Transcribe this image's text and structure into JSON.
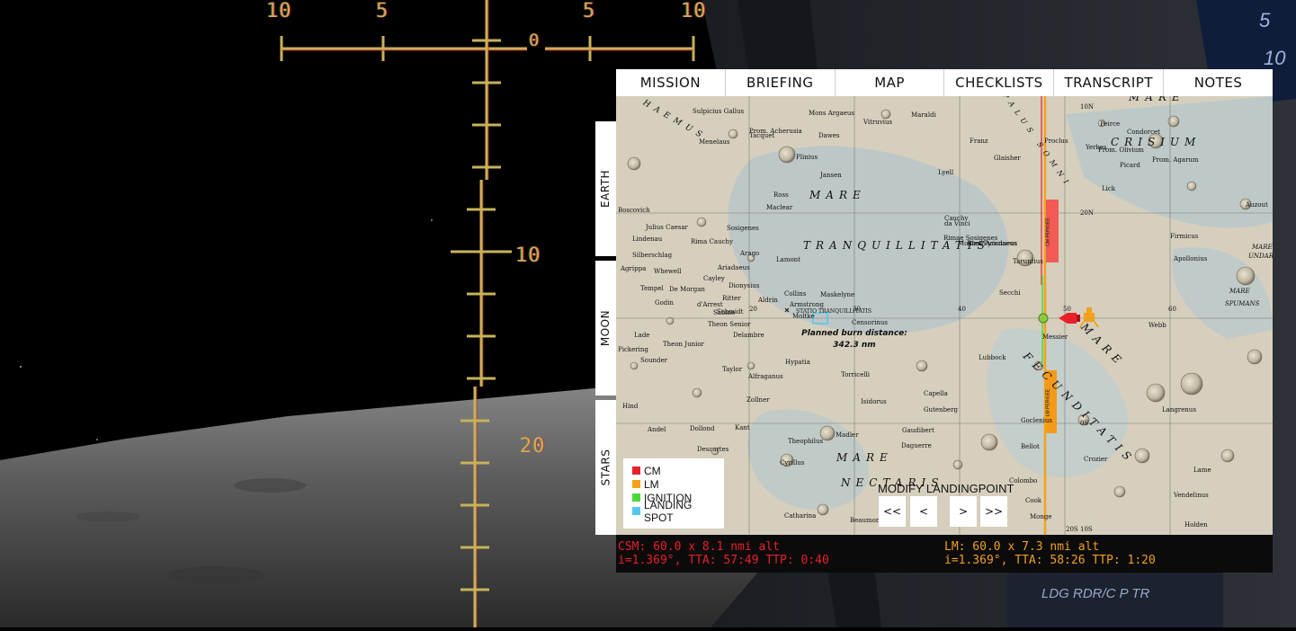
{
  "hud": {
    "scale_labels": [
      "10",
      "5",
      "0",
      "5",
      "10"
    ],
    "pitch_labels": [
      "10",
      "20"
    ]
  },
  "cockpit": {
    "label": "LDG RDR/C P TR",
    "gauge_digits": [
      "5",
      "10"
    ]
  },
  "tabs": [
    "MISSION",
    "BRIEFING",
    "MAP",
    "CHECKLISTS",
    "TRANSCRIPT",
    "NOTES"
  ],
  "side_tabs": [
    "EARTH",
    "MOON",
    "STARS"
  ],
  "map": {
    "mare_labels": [
      "MARE",
      "TRANQUILLITATIS",
      "MARE",
      "CRISIUM",
      "MARE",
      "FECUNDITATIS",
      "MARE",
      "NECTARIS",
      "HAEMUS",
      "PALUS SOMNI",
      "MARE",
      "SPUMANS",
      "MARE",
      "UNDARUM"
    ],
    "crater_labels": [
      "Sulpicius Gallus",
      "Menelaus",
      "Plinius",
      "Dawes",
      "Vitruvius",
      "Maraldi",
      "Jansen",
      "Ross",
      "Maclear",
      "Boscovich",
      "Julius Caesar",
      "Sosigenes",
      "Arago",
      "Lamont",
      "Silberschlag",
      "Agrippa",
      "Whewell",
      "Ariadaeus",
      "Cayley",
      "Dionysius",
      "Tempel",
      "De Morgan",
      "Ritter",
      "Godin",
      "d'Arrest",
      "Schmidt",
      "Sabine",
      "Aldrin",
      "Collins",
      "Armstrong",
      "Moltke",
      "Maskelyne",
      "Censorinus",
      "Theon Senior",
      "Delambre",
      "Lade",
      "Theon Junior",
      "Pickering",
      "Sounder",
      "Hypatia",
      "Taylor",
      "Alfraganus",
      "Torricelli",
      "Zollner",
      "Isidorus",
      "Capella",
      "Gutenberg",
      "Kant",
      "Hind",
      "Andel",
      "Dollond",
      "Descartes",
      "Theophilus",
      "Madler",
      "Gaudibert",
      "Daguerre",
      "Cyrillus",
      "Catharina",
      "Beaumont",
      "Proclus",
      "Peirce",
      "Picard",
      "Yerkes",
      "Lick",
      "Taruntius",
      "Secchi",
      "Messier",
      "Lubbock",
      "Goclenius",
      "Bellot",
      "Crozier",
      "Colombo",
      "Cook",
      "Monge",
      "Webb",
      "Langrenus",
      "Lame",
      "Vendelinus",
      "Holden",
      "Firmicus",
      "Apollonius",
      "Auzout",
      "Condorcet",
      "Lyell",
      "da Vinci",
      "Cauchy",
      "Franz",
      "Glaisher",
      "Prom. Agarum",
      "Prom. Olivium",
      "Mons Argaeus",
      "Tacquet",
      "Prom. Acherusia",
      "Lindenau",
      "Rima Ariadaeus",
      "Rima Cauchy",
      "Rimae Sosigenes",
      "Montes Pyrenaeus"
    ],
    "grid_labels": [
      "20",
      "30",
      "40",
      "50",
      "60",
      "10N",
      "20N",
      "0S",
      "10S",
      "20S"
    ],
    "station_label": "STATIO TRANQUILLITATIS",
    "burn_title": "Planned burn distance:",
    "burn_value": "342.3 nm",
    "cm_bar_label": "CM PERIGEE",
    "lm_bar_label": "LM PERIGEE",
    "colors": {
      "cm": "#e8202a",
      "lm": "#f2a21a",
      "ignition": "#4ed83a",
      "landing": "#53c8ea"
    }
  },
  "legend": [
    {
      "label": "CM",
      "color": "#e8202a"
    },
    {
      "label": "LM",
      "color": "#f2a21a"
    },
    {
      "label": "IGNITION",
      "color": "#4ed83a"
    },
    {
      "label": "LANDING SPOT",
      "color": "#53c8ea"
    }
  ],
  "controls": {
    "modify": "MODIFY LANDINGPOINT",
    "buttons": [
      "<<",
      "<",
      ">",
      ">>"
    ]
  },
  "status": {
    "csm_line1": "CSM: 60.0 x 8.1 nmi alt",
    "csm_line2": "i=1.369°, TTA: 57:49 TTP: 0:40",
    "lm_line1": "LM: 60.0 x 7.3 nmi alt",
    "lm_line2": "i=1.369°, TTA: 58:26 TTP: 1:20"
  }
}
